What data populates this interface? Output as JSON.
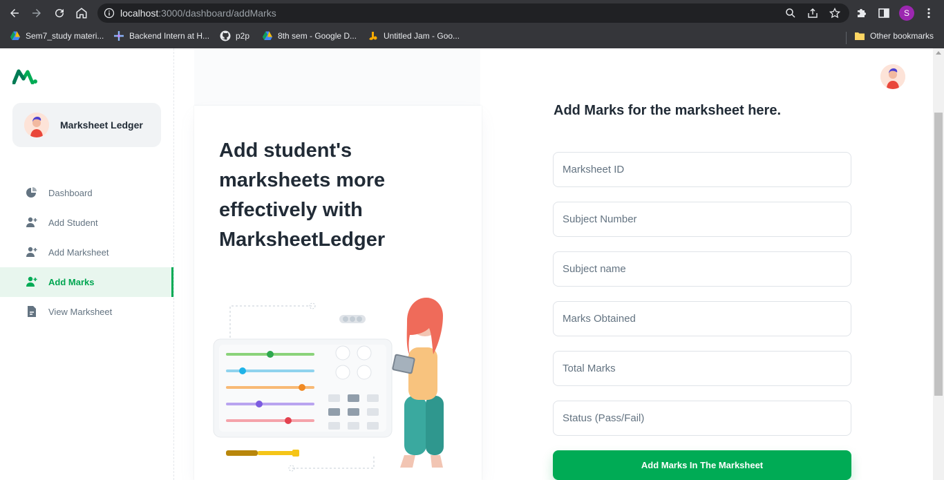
{
  "browser": {
    "url_host": "localhost",
    "url_path": ":3000/dashboard/addMarks",
    "profile_initial": "S",
    "bookmarks": [
      {
        "label": "Sem7_study materi...",
        "icon": "google-drive-icon"
      },
      {
        "label": "Backend Intern at H...",
        "icon": "sparkle-icon"
      },
      {
        "label": "p2p",
        "icon": "github-icon"
      },
      {
        "label": "8th sem - Google D...",
        "icon": "google-drive-icon"
      },
      {
        "label": "Untitled Jam - Goo...",
        "icon": "jamboard-icon"
      }
    ],
    "other_bookmarks": "Other bookmarks"
  },
  "sidebar": {
    "account_name": "Marksheet Ledger",
    "items": [
      {
        "label": "Dashboard",
        "icon": "pie-chart-icon",
        "active": false
      },
      {
        "label": "Add Student",
        "icon": "add-user-icon",
        "active": false
      },
      {
        "label": "Add Marksheet",
        "icon": "add-user-icon",
        "active": false
      },
      {
        "label": "Add Marks",
        "icon": "add-user-icon",
        "active": true
      },
      {
        "label": "View Marksheet",
        "icon": "document-icon",
        "active": false
      }
    ]
  },
  "hero": {
    "title": "Add student's marksheets more effectively with MarksheetLedger"
  },
  "form": {
    "title": "Add Marks for the marksheet here.",
    "fields": [
      {
        "placeholder": "Marksheet ID",
        "value": ""
      },
      {
        "placeholder": "Subject Number",
        "value": ""
      },
      {
        "placeholder": "Subject name",
        "value": ""
      },
      {
        "placeholder": "Marks Obtained",
        "value": ""
      },
      {
        "placeholder": "Total Marks",
        "value": ""
      },
      {
        "placeholder": "Status (Pass/Fail)",
        "value": ""
      }
    ],
    "submit_label": "Add Marks In The Marksheet"
  },
  "colors": {
    "accent": "#00ab55",
    "active_bg": "#e8f6ee",
    "text_primary": "#212b36",
    "text_secondary": "#637381"
  }
}
